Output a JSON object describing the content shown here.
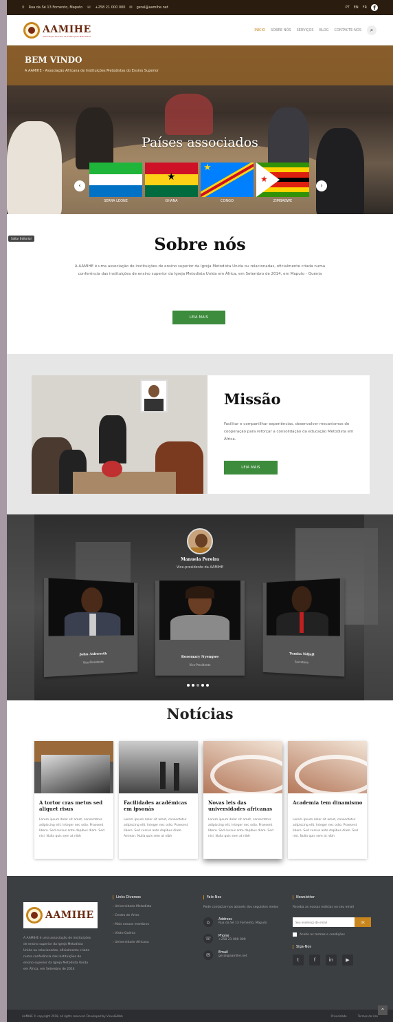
{
  "topbar": {
    "address": "Rua da Sé 13 Fomento, Maputo",
    "phone": "+258 21 000 000",
    "email": "geral@aamihe.net",
    "langs": [
      "PT",
      "EN",
      "FR"
    ]
  },
  "header": {
    "logo_text": "AAMIHE",
    "logo_sub": "Associação Africana de Instituições Metodistas",
    "nav": [
      "INÍCIO",
      "SOBRE NÓS",
      "SERVIÇOS",
      "BLOG",
      "CONTACTE-NOS"
    ]
  },
  "hero": {
    "title": "BEM VINDO",
    "subtitle": "A AAMIHE - Associação Africana de Instituições Metodistas do Ensino Superior",
    "countries_heading": "Países associados",
    "countries": [
      "SERRA LEONE",
      "GHANA",
      "CONGO",
      "ZIMBABWE"
    ],
    "prev": "‹",
    "next": "›"
  },
  "about": {
    "skip_label": "Saltar Editorial",
    "heading": "Sobre nós",
    "text": "A AAMIHE é uma associação de instituições de ensino superior da Igreja Metodista Unida ou relacionadas, oficialmente criada numa conferência das instituições de ensino superior da Igreja Metodista Unida em África, em Setembro de 2014, em Maputo - Quénia",
    "button": "LEIA MAIS"
  },
  "mission": {
    "heading": "Missão",
    "text": "Facilitar e compartilhar experiências, desenvolver mecanismos de cooperação para reforçar a consolidação da educação Metodista em África.",
    "button": "LEIA MAIS"
  },
  "team": {
    "leader_name": "Manuela Pereira",
    "leader_role": "Vice-presidente da AAMIHE",
    "members": [
      {
        "name": "John Ashworth",
        "role": "Vice-Presidente"
      },
      {
        "name": "Rosemary Nyengwe",
        "role": "Vice-Presidente"
      },
      {
        "name": "Tumba Ndjaji",
        "role": "Secretário"
      }
    ]
  },
  "news": {
    "heading": "Notícias",
    "items": [
      {
        "title": "A tortor cras metus sed aliquet risus",
        "text": "Lorem ipsum dolor sit amet, consectetur adipiscing elit. Integer nec odio. Praesent libero. Sed cursus ante dapibus diam. Sed nisi. Nulla quis sem at nibh"
      },
      {
        "title": "Facilidades académicas em ipsonás",
        "text": "Lorem ipsum dolor sit amet, consectetur adipiscing elit. Integer nec odio. Praesent libero. Sed cursus ante dapibus diam. Aenean. Nulla quis sem at nibh"
      },
      {
        "title": "Novas leis das universidades africanas",
        "text": "Lorem ipsum dolor sit amet, consectetur adipiscing elit. Integer nec odio. Praesent libero. Sed cursus ante dapibus diam. Sed nisi. Nulla quis sem at nibh"
      },
      {
        "title": "Academia tem dinamismo",
        "text": "Lorem ipsum dolor sit amet, consectetur adipiscing elit. Integer nec odio. Praesent libero. Sed cursus ante dapibus diam. Sed nisi. Nulla quis sem at nibh"
      }
    ]
  },
  "footer": {
    "about": "A AAMIHE é uma associação de instituições de ensino superior da Igreja Metodista Unida ou relacionadas, oficialmente criada numa conferência das instituições de ensino superior da Igreja Metodista Unida em África, em Setembro de 2014",
    "links_heading": "Links Diversos",
    "links": [
      "Universidade Metodista",
      "Centro de Artes",
      "Mais nossos membros",
      "Visite Quénia",
      "Universidade Africana"
    ],
    "contacts_heading": "Fale-Nos",
    "contacts_intro": "Pode contactar-nos através dos seguintes meios",
    "contacts": [
      {
        "icon": "⌂",
        "label": "Address",
        "value": "Rua da Sé 13 Fomento, Maputo"
      },
      {
        "icon": "☏",
        "label": "Phone",
        "value": "+258 21 000 000"
      },
      {
        "icon": "✉",
        "label": "Email",
        "value": "geral@aamihe.net"
      }
    ],
    "newsletter_heading": "Newsletter",
    "newsletter_text": "Receba as nossas notícias no seu email",
    "newsletter_placeholder": "Seu endereço de email",
    "newsletter_button": "OK",
    "consent": "Aceito os termos e condições",
    "social_heading": "Siga-Nos",
    "social": [
      "t",
      "f",
      "in",
      "▶"
    ],
    "copyright": "AAMIHE © copyright 2018, all rights reserved. Developed by Visual&Web",
    "bottom_links": [
      "Privacidade",
      "Termos de Uso"
    ]
  },
  "colors": {
    "accent": "#c8861c",
    "button_green": "#3d8b3d",
    "topbar": "#2a1d10",
    "footer": "#3c3f42"
  }
}
